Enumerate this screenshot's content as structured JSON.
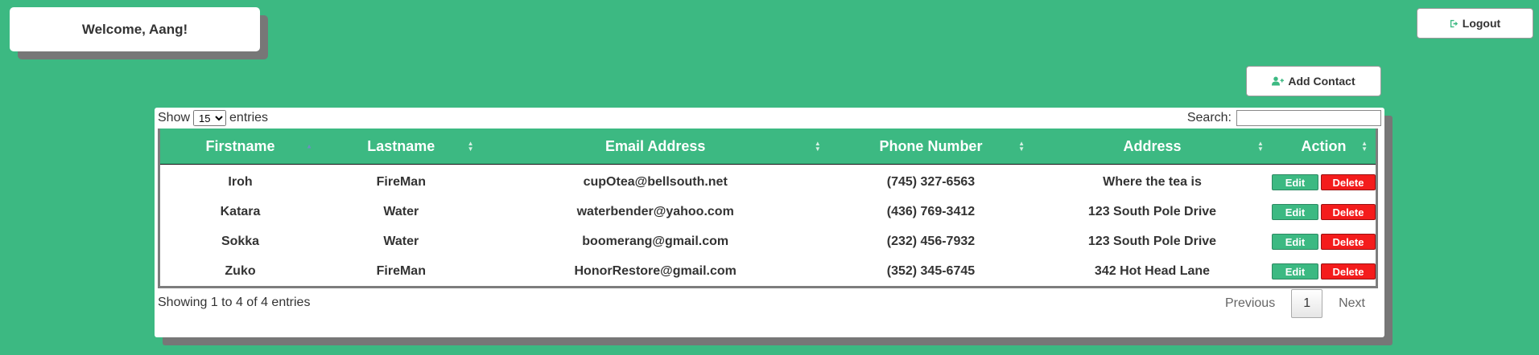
{
  "header": {
    "welcome_text": "Welcome, Aang!",
    "logout_label": "Logout",
    "add_contact_label": "Add Contact"
  },
  "table_controls": {
    "show_label": "Show",
    "entries_label": "entries",
    "page_size_value": "15",
    "search_label": "Search:",
    "search_value": ""
  },
  "columns": [
    "Firstname",
    "Lastname",
    "Email Address",
    "Phone Number",
    "Address",
    "Action"
  ],
  "rows": [
    {
      "firstname": "Iroh",
      "lastname": "FireMan",
      "email": "cupOtea@bellsouth.net",
      "phone": "(745) 327-6563",
      "address": "Where the tea is"
    },
    {
      "firstname": "Katara",
      "lastname": "Water",
      "email": "waterbender@yahoo.com",
      "phone": "(436) 769-3412",
      "address": "123 South Pole Drive"
    },
    {
      "firstname": "Sokka",
      "lastname": "Water",
      "email": "boomerang@gmail.com",
      "phone": "(232) 456-7932",
      "address": "123 South Pole Drive"
    },
    {
      "firstname": "Zuko",
      "lastname": "FireMan",
      "email": "HonorRestore@gmail.com",
      "phone": "(352) 345-6745",
      "address": "342 Hot Head Lane"
    }
  ],
  "row_actions": {
    "edit_label": "Edit",
    "delete_label": "Delete"
  },
  "footer": {
    "showing_text": "Showing 1 to 4 of 4 entries",
    "previous_label": "Previous",
    "current_page": "1",
    "next_label": "Next"
  },
  "icons": {
    "logout": "sign-out-icon",
    "add_contact": "user-plus-icon",
    "sort": "sort-icon"
  },
  "colors": {
    "background": "#3cb982",
    "header": "#3cb982",
    "edit_button": "#3cb982",
    "delete_button": "#f41c1c",
    "shadow": "#777777"
  }
}
